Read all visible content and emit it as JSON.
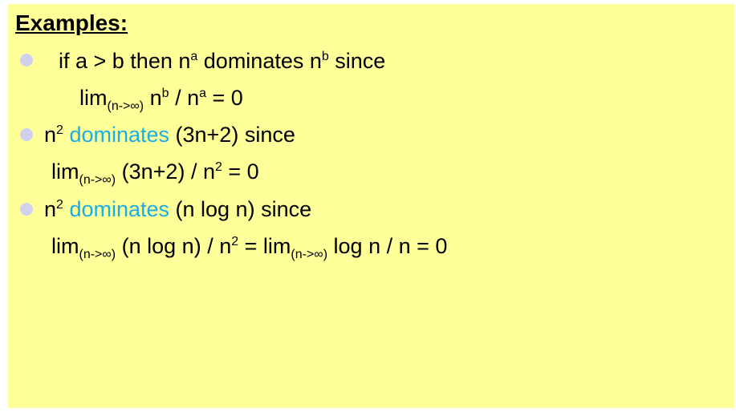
{
  "title": "Examples:",
  "accent_color": "#1aaee8",
  "bullet_color": "#d1d1ee",
  "background_color": "#ffff99",
  "lines": {
    "l1": {
      "a": "if a > b then n",
      "sup1": "a",
      "b": " dominates n",
      "sup2": "b",
      "c": " since"
    },
    "l2": {
      "a": "lim",
      "sub": "(n->∞)",
      "b": " n",
      "sup1": "b",
      "c": " / n",
      "sup2": "a",
      "d": " = 0"
    },
    "l3": {
      "a": "n",
      "sup": "2",
      "dom": " dominates",
      "b": " (3n+2) since"
    },
    "l4": {
      "a": "lim",
      "sub": "(n->∞)",
      "b": " (3n+2) / n",
      "sup": "2",
      "c": " = 0"
    },
    "l5": {
      "a": "n",
      "sup": "2",
      "dom": " dominates",
      "b": " (n log n) since"
    },
    "l6": {
      "a": "lim",
      "sub1": "(n->∞)",
      "b": " (n log n) / n",
      "sup": "2",
      "c": " = lim",
      "sub2": "(n->∞)",
      "d": " log n / n = 0"
    }
  }
}
